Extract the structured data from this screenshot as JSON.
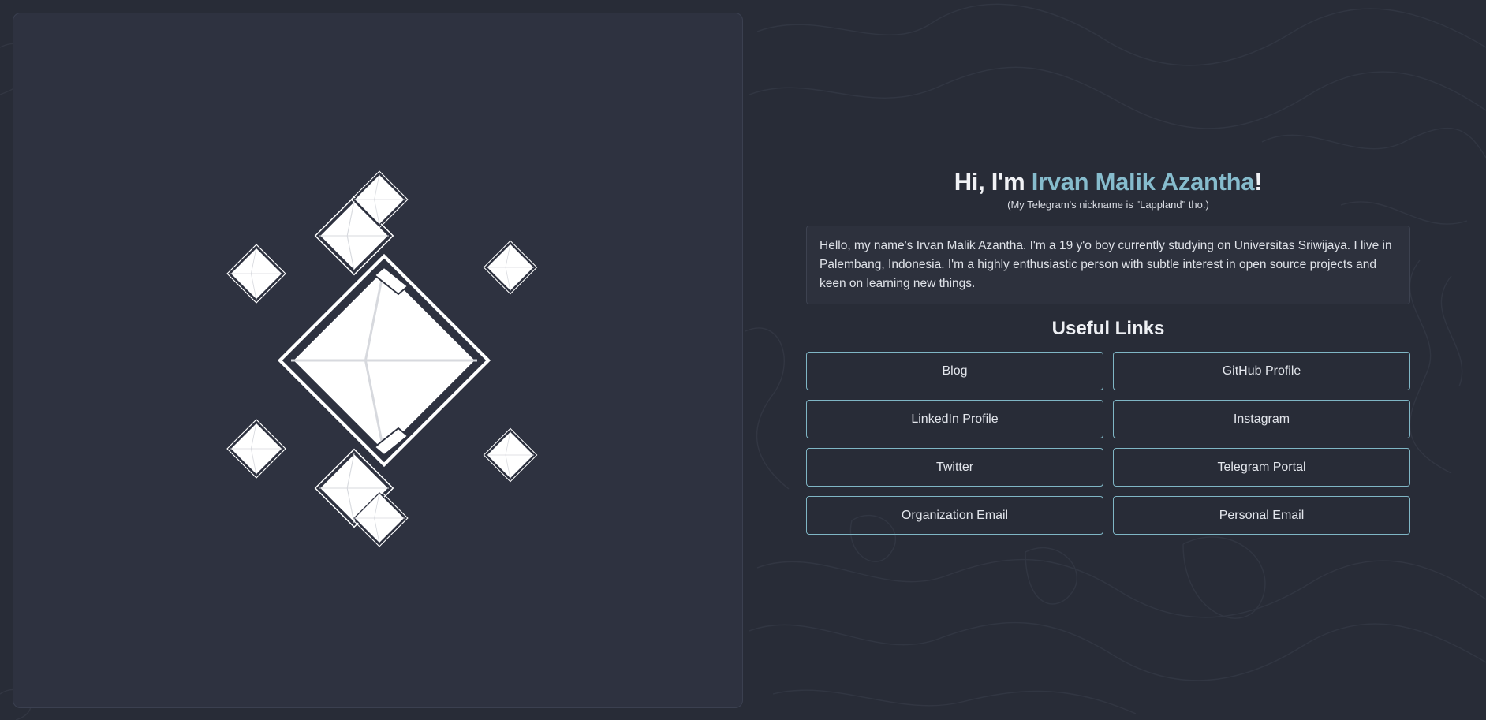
{
  "hero": {
    "greeting": "Hi, I'm ",
    "name": "Irvan Malik Azantha",
    "exclaim": "!",
    "subtitle": "(My Telegram's nickname is \"Lappland\" tho.)"
  },
  "bio": {
    "text": "Hello, my name's Irvan Malik Azantha. I'm a 19 y'o boy currently studying on Universitas Sriwijaya. I live in Palembang, Indonesia. I'm a highly enthusiastic person with subtle interest in open source projects and keen on learning new things."
  },
  "links": {
    "heading": "Useful Links",
    "items": [
      {
        "label": "Blog"
      },
      {
        "label": "GitHub Profile"
      },
      {
        "label": "LinkedIn Profile"
      },
      {
        "label": "Instagram"
      },
      {
        "label": "Twitter"
      },
      {
        "label": "Telegram Portal"
      },
      {
        "label": "Organization Email"
      },
      {
        "label": "Personal Email"
      }
    ]
  },
  "colors": {
    "background": "#282c37",
    "panel": "#2e3240",
    "accent": "#86bccd",
    "button_border": "#7fb6c5",
    "text": "#e6e8ee"
  }
}
